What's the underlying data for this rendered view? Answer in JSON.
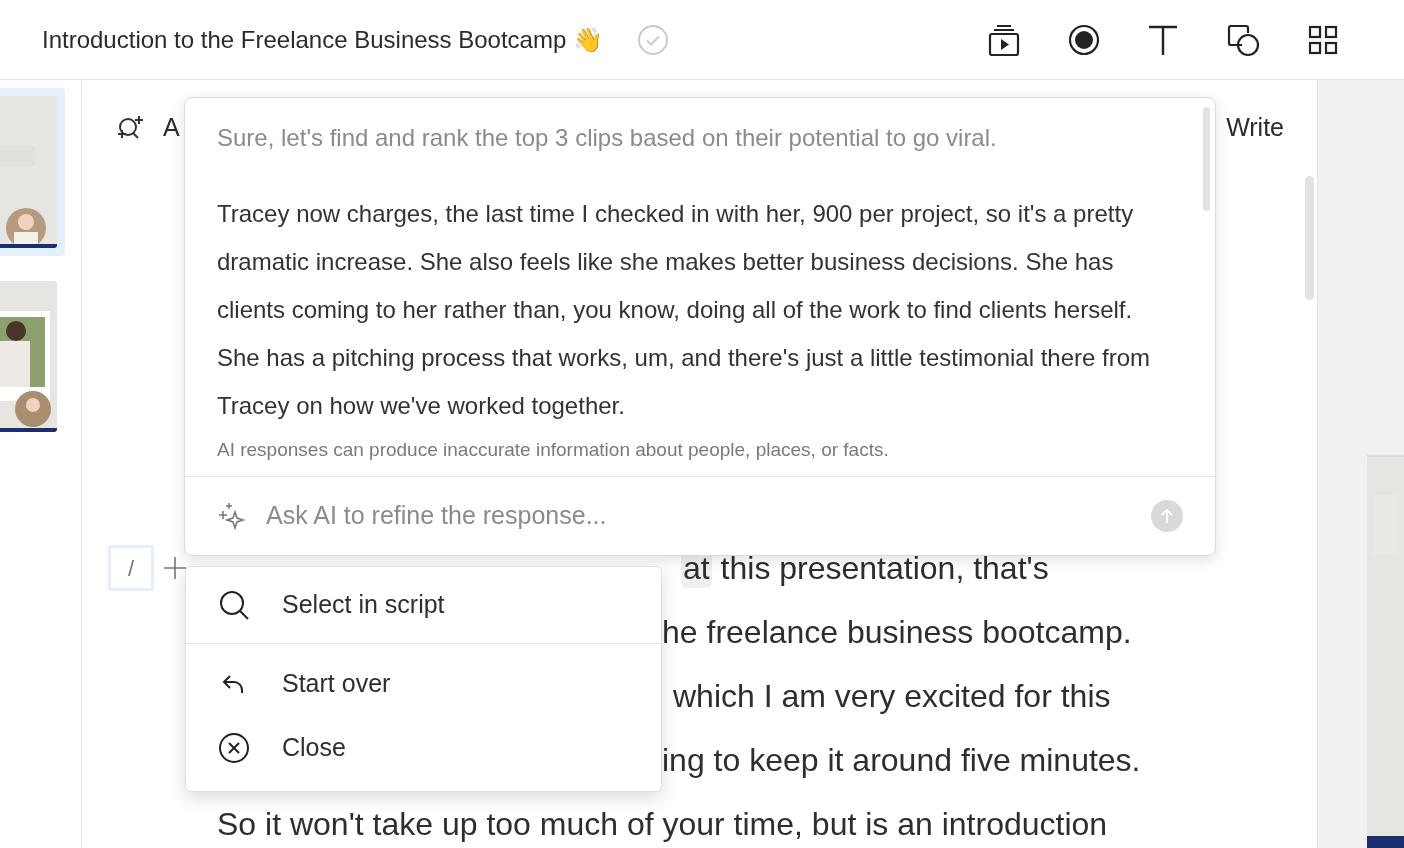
{
  "header": {
    "title": "Introduction to the Freelance Business Bootcamp 👋"
  },
  "slides": [
    {
      "kind": "picture",
      "selected": true
    },
    {
      "kind": "picture",
      "selected": false
    }
  ],
  "editor_toolbar": {
    "partial_label": "A",
    "write_label": "Write"
  },
  "ai_panel": {
    "intro": "Sure, let's find and rank the top 3 clips based on their potential to go viral.",
    "response": "Tracey now charges, the last time I checked in with her, 900 per project, so it's a pretty dramatic increase. She also feels like she makes better business decisions. She has clients coming to her rather than, you know, doing all of the work to find clients herself. She has a pitching process that works, um, and there's just a little testimonial there from Tracey on how we've worked together.",
    "disclaimer": "AI responses can produce inaccurate information about people, places, or facts.",
    "input": {
      "placeholder": "Ask AI to refine the response..."
    }
  },
  "slash_field": {
    "value": "/"
  },
  "script_lines": [
    {
      "highlight": "at",
      "after": " this presentation, that's"
    },
    {
      "text": "he freelance business bootcamp."
    },
    {
      "text": "which I am very excited for this"
    },
    {
      "text": "ing to keep it around five minutes."
    },
    {
      "text": "So it won't take up too much of your time, but is an introduction"
    }
  ],
  "menu": {
    "groups": [
      [
        {
          "kind": "search",
          "label": "Select in script"
        }
      ],
      [
        {
          "kind": "undo",
          "label": "Start over"
        },
        {
          "kind": "close",
          "label": "Close"
        }
      ]
    ]
  }
}
